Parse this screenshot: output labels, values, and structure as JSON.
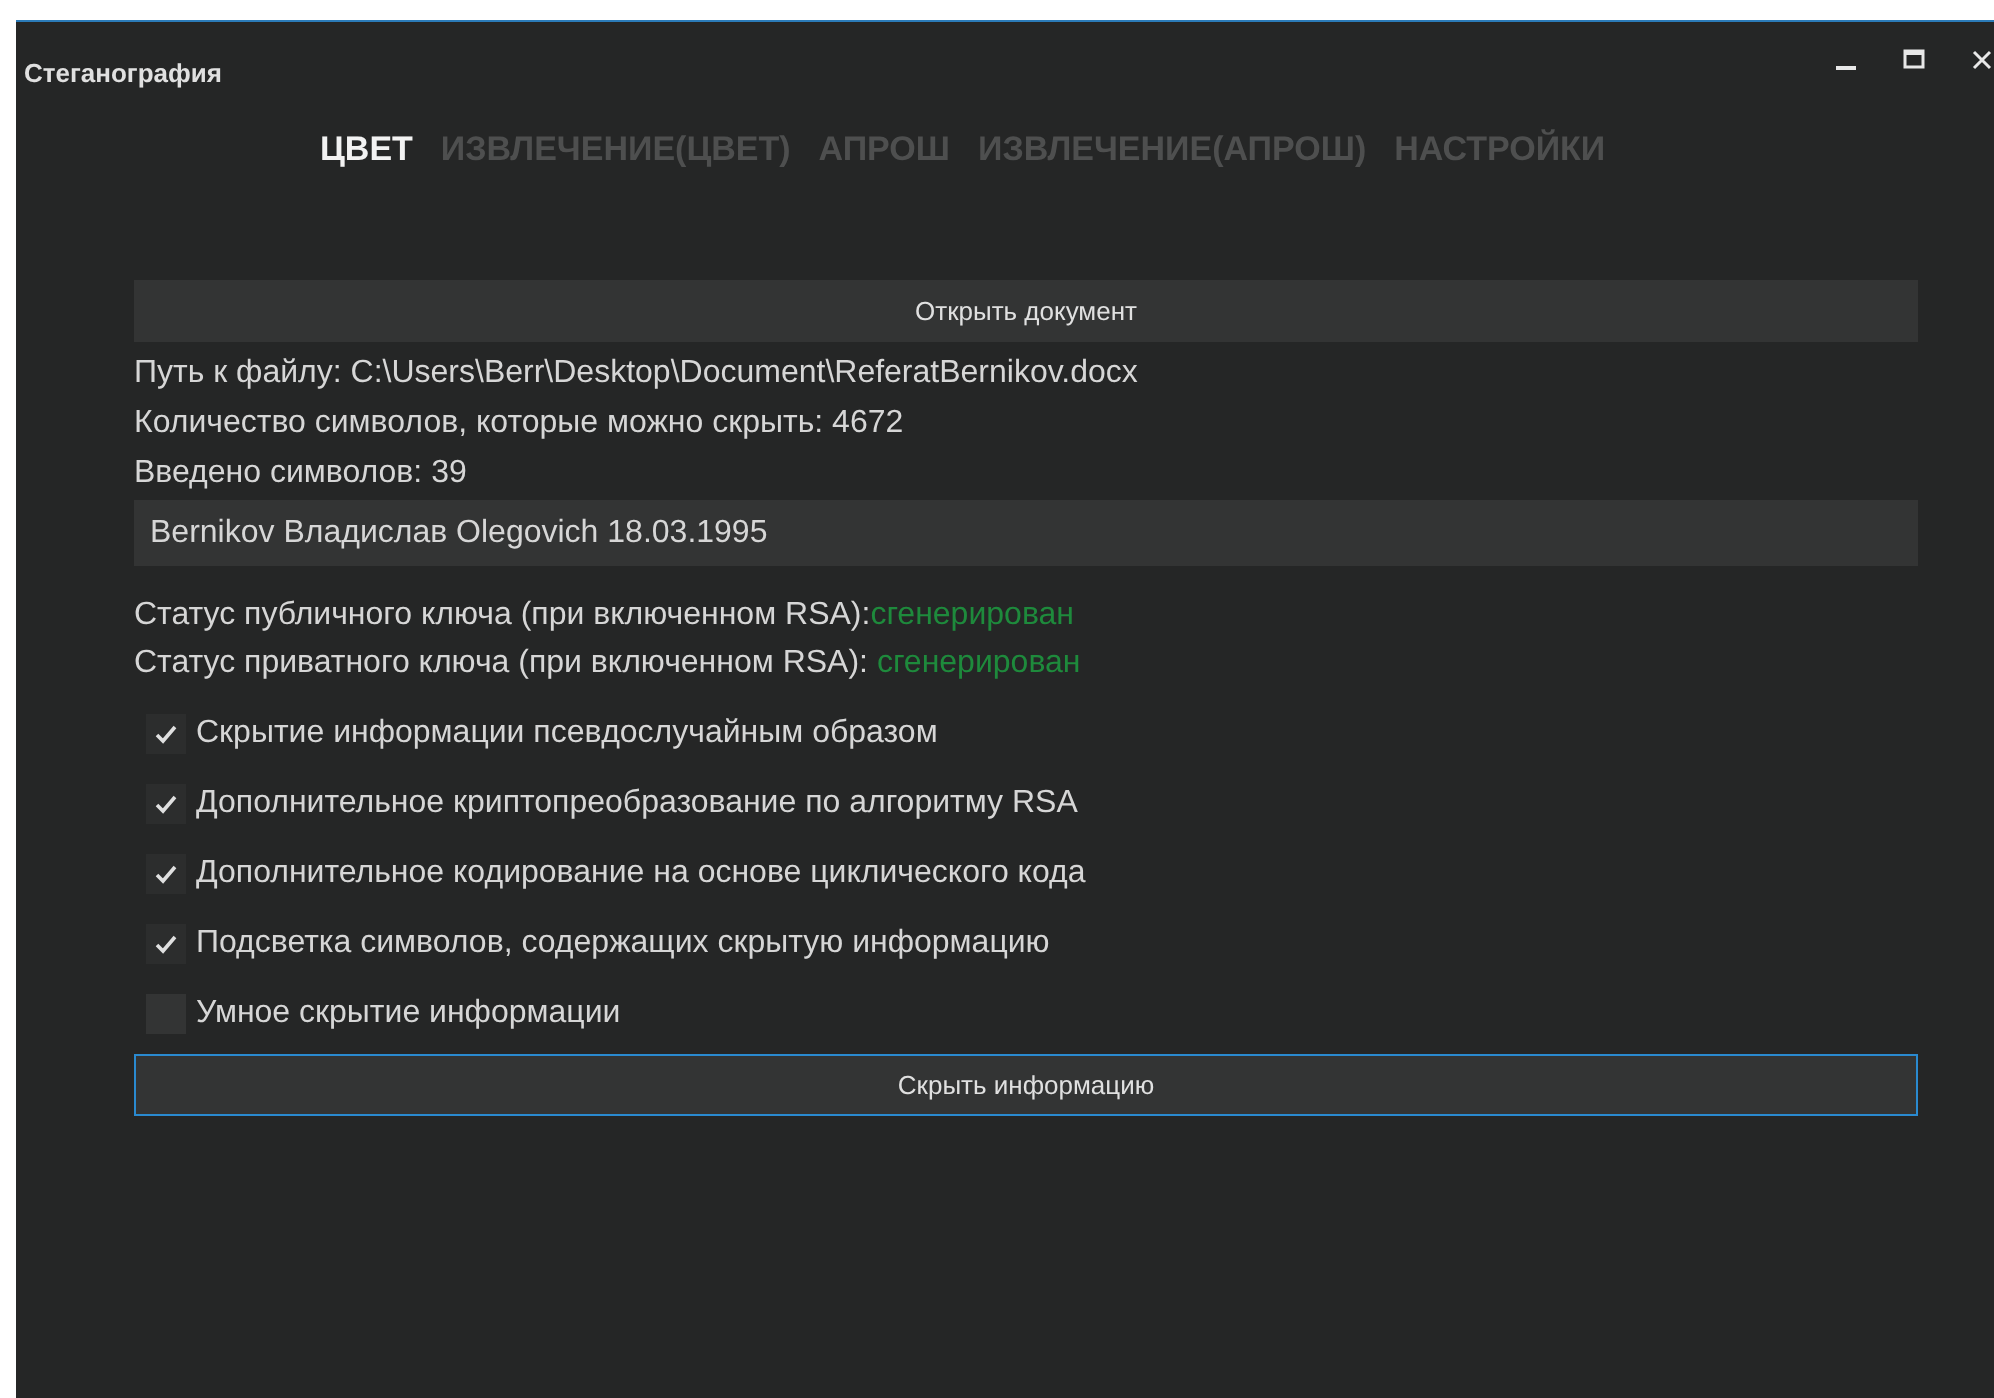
{
  "window": {
    "title": "Стеганография"
  },
  "tabs": [
    {
      "label": "ЦВЕТ",
      "selected": true
    },
    {
      "label": "ИЗВЛЕЧЕНИЕ(ЦВЕТ)",
      "selected": false
    },
    {
      "label": "АПРОШ",
      "selected": false
    },
    {
      "label": "ИЗВЛЕЧЕНИЕ(АПРОШ)",
      "selected": false
    },
    {
      "label": "НАСТРОЙКИ",
      "selected": false
    }
  ],
  "open_button": "Открыть документ",
  "info_lines": [
    "Путь к файлу: C:\\Users\\Berr\\Desktop\\Document\\ReferatBernikov.docx",
    "Количество символов, которые можно скрыть: 4672",
    "Введено символов: 39"
  ],
  "message_field": {
    "value": "Bernikov Владислав Olegovich 18.03.1995"
  },
  "key_status": [
    {
      "label": "Статус публичного ключа (при включенном RSA):",
      "status": "сгенерирован",
      "color": "#1e8a3c"
    },
    {
      "label": "Статус приватного ключа (при включенном RSA): ",
      "status": "сгенерирован",
      "color": "#1e8a3c"
    }
  ],
  "options": [
    {
      "label": "Скрытие информации псевдослучайным образом",
      "checked": true
    },
    {
      "label": "Дополнительное криптопреобразование по алгоритму RSA",
      "checked": true
    },
    {
      "label": "Дополнительное кодирование на основе циклического кода",
      "checked": true
    },
    {
      "label": "Подсветка символов, содержащих скрытую информацию",
      "checked": true
    },
    {
      "label": "Умное скрытие информации",
      "checked": false
    }
  ],
  "hide_button": "Скрыть информацию"
}
